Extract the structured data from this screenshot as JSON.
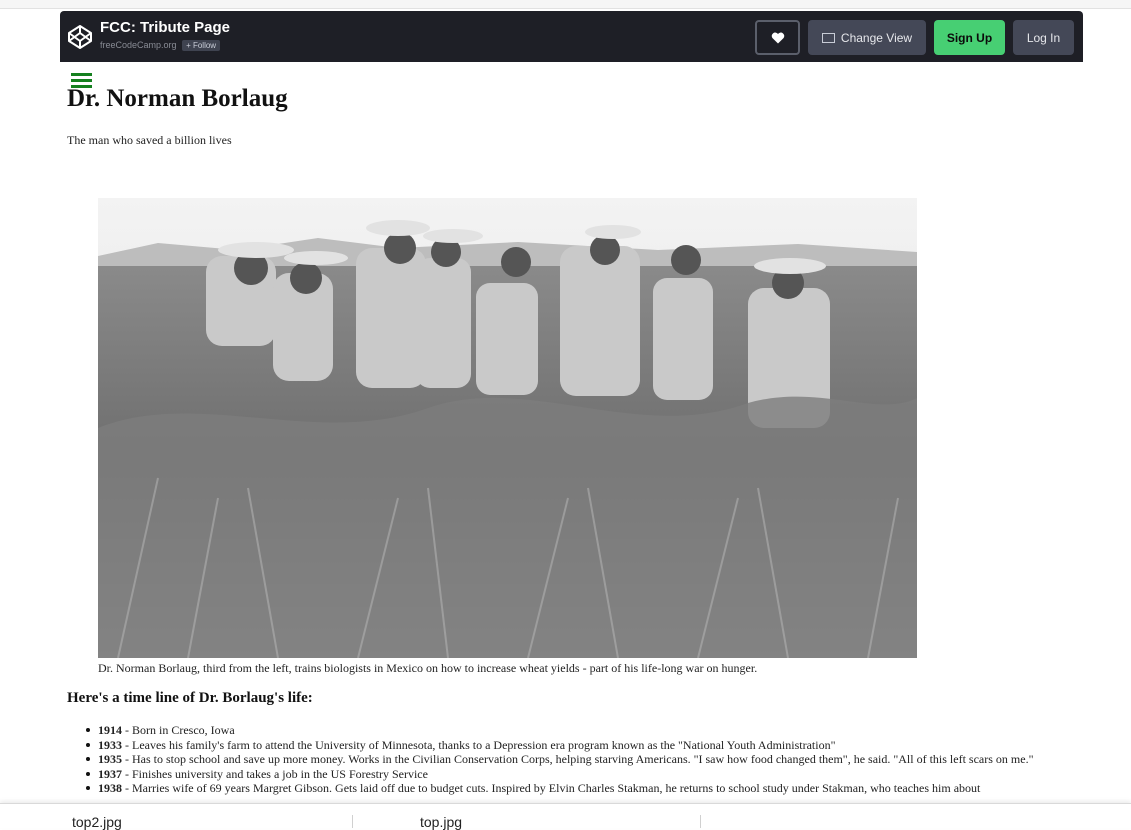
{
  "header": {
    "title": "FCC: Tribute Page",
    "author": "freeCodeCamp.org",
    "follow_label": "+ Follow",
    "change_view_label": "Change View",
    "signup_label": "Sign Up",
    "login_label": "Log In",
    "colors": {
      "bar": "#1e1f26",
      "signup": "#47cf73",
      "button": "#444857"
    }
  },
  "page": {
    "title": "Dr. Norman Borlaug",
    "tagline": "The man who saved a billion lives",
    "caption": "Dr. Norman Borlaug, third from the left, trains biologists in Mexico on how to increase wheat yields - part of his life-long war on hunger.",
    "timeline_heading": "Here's a time line of Dr. Borlaug's life:",
    "menu_color": "#15801f",
    "timeline": [
      {
        "year": "1914",
        "text": " - Born in Cresco, Iowa"
      },
      {
        "year": "1933",
        "text": " - Leaves his family's farm to attend the University of Minnesota, thanks to a Depression era program known as the \"National Youth Administration\""
      },
      {
        "year": "1935",
        "text": " - Has to stop school and save up more money. Works in the Civilian Conservation Corps, helping starving Americans. \"I saw how food changed them\", he said. \"All of this left scars on me.\""
      },
      {
        "year": "1937",
        "text": " - Finishes university and takes a job in the US Forestry Service"
      },
      {
        "year": "1938",
        "text": " - Marries wife of 69 years Margret Gibson. Gets laid off due to budget cuts. Inspired by Elvin Charles Stakman, he returns to school study under Stakman, who teaches him about"
      }
    ]
  },
  "downloads": {
    "file1": "top2.jpg",
    "file2": "top.jpg"
  }
}
